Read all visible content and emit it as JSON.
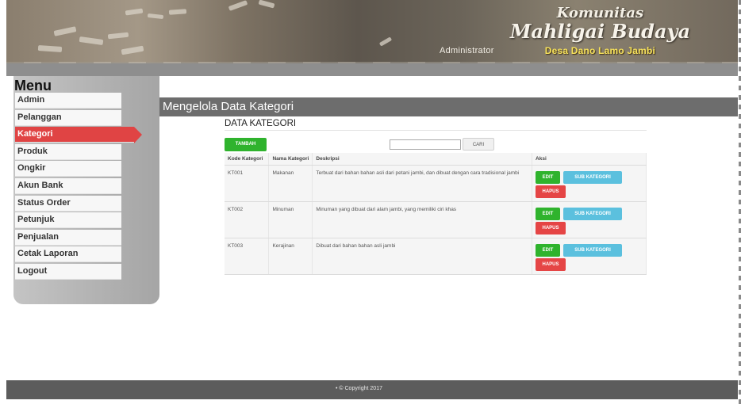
{
  "header": {
    "user_label": "Administrator",
    "brand_line1": "Komunitas",
    "brand_line2": "Mahligai Budaya",
    "brand_line3": "Desa Dano Lamo Jambi"
  },
  "sidebar": {
    "title": "Menu",
    "items": [
      {
        "label": "Admin"
      },
      {
        "label": "Pelanggan"
      },
      {
        "label": "Kategori",
        "active": true
      },
      {
        "label": "Produk"
      },
      {
        "label": "Ongkir"
      },
      {
        "label": "Akun Bank"
      },
      {
        "label": "Status Order"
      },
      {
        "label": "Petunjuk"
      },
      {
        "label": "Penjualan"
      },
      {
        "label": "Cetak Laporan"
      },
      {
        "label": "Logout"
      }
    ]
  },
  "page": {
    "title": "Mengelola Data Kategori",
    "section_title": "DATA KATEGORI",
    "add_button": "TAMBAH",
    "search_value": "",
    "search_button": "CARI"
  },
  "table": {
    "headers": {
      "kode": "Kode Kategori",
      "nama": "Nama Kategori",
      "deskripsi": "Deskripsi",
      "aksi": "Aksi"
    },
    "rows": [
      {
        "kode": "KT001",
        "nama": "Makanan",
        "deskripsi": "Terbuat dari bahan bahan asli dari petani jambi, dan dibuat dengan cara tradisional jambi"
      },
      {
        "kode": "KT002",
        "nama": "Minuman",
        "deskripsi": "Minuman yang dibuat dari alam jambi, yang memiliki ciri khas"
      },
      {
        "kode": "KT003",
        "nama": "Kerajinan",
        "deskripsi": "Dibuat dari bahan bahan asli jambi"
      }
    ],
    "actions": {
      "edit": "EDIT",
      "sub": "SUB KATEGORI",
      "hapus": "HAPUS"
    }
  },
  "footer": {
    "text": "• © Copyright 2017"
  },
  "colors": {
    "active_menu": "#e04444",
    "add_button": "#2fb32d",
    "sub_button": "#5bc0de",
    "delete_button": "#e54545",
    "title_bar": "#6d6d6d"
  }
}
